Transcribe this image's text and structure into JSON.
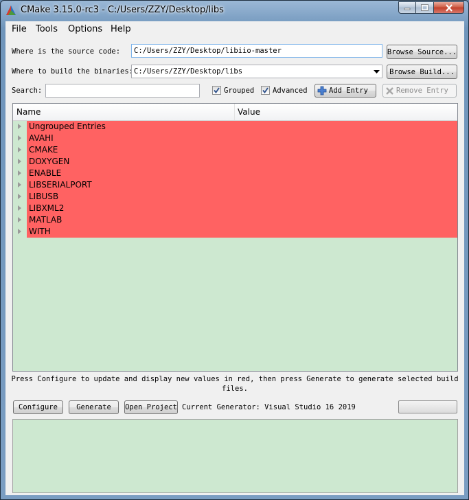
{
  "window": {
    "title": "CMake 3.15.0-rc3 - C:/Users/ZZY/Desktop/libs"
  },
  "menu": [
    "File",
    "Tools",
    "Options",
    "Help"
  ],
  "source": {
    "label": "Where is the source code:",
    "value": "C:/Users/ZZY/Desktop/libiio-master",
    "browse": "Browse Source..."
  },
  "build": {
    "label": "Where to build the binaries:",
    "value": "C:/Users/ZZY/Desktop/libs",
    "browse": "Browse Build..."
  },
  "search": {
    "label": "Search:",
    "value": ""
  },
  "options": {
    "grouped": "Grouped",
    "grouped_checked": true,
    "advanced": "Advanced",
    "advanced_checked": true
  },
  "actions": {
    "add_entry": "Add Entry",
    "remove_entry": "Remove Entry"
  },
  "table": {
    "columns": [
      "Name",
      "Value"
    ],
    "rows": [
      "Ungrouped Entries",
      "AVAHI",
      "CMAKE",
      "DOXYGEN",
      "ENABLE",
      "LIBSERIALPORT",
      "LIBUSB",
      "LIBXML2",
      "MATLAB",
      "WITH"
    ],
    "row_color": "#ff6262",
    "background": "#cde8d0"
  },
  "message": "Press Configure to update and display new values in red, then press Generate to generate selected build files.",
  "buttons": {
    "configure": "Configure",
    "generate": "Generate",
    "open_project": "Open Project"
  },
  "generator": "Current Generator: Visual Studio 16 2019"
}
